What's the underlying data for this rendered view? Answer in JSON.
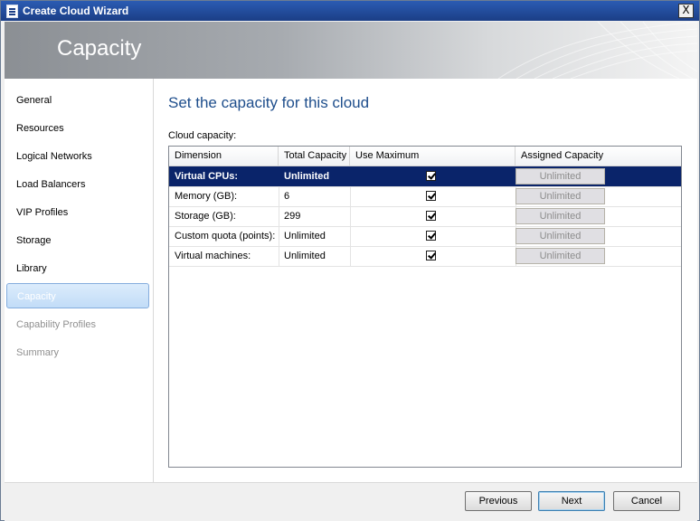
{
  "window": {
    "title": "Create Cloud Wizard",
    "close_label": "X"
  },
  "banner": {
    "heading": "Capacity"
  },
  "sidebar": {
    "items": [
      {
        "label": "General",
        "state": "normal"
      },
      {
        "label": "Resources",
        "state": "normal"
      },
      {
        "label": "Logical Networks",
        "state": "normal"
      },
      {
        "label": "Load Balancers",
        "state": "normal"
      },
      {
        "label": "VIP Profiles",
        "state": "normal"
      },
      {
        "label": "Storage",
        "state": "normal"
      },
      {
        "label": "Library",
        "state": "normal"
      },
      {
        "label": "Capacity",
        "state": "selected"
      },
      {
        "label": "Capability Profiles",
        "state": "disabled"
      },
      {
        "label": "Summary",
        "state": "disabled"
      }
    ]
  },
  "main": {
    "heading": "Set the capacity for this cloud",
    "section_label": "Cloud capacity:",
    "columns": [
      "Dimension",
      "Total Capacity",
      "Use Maximum",
      "Assigned Capacity"
    ],
    "rows": [
      {
        "dimension": "Virtual CPUs:",
        "total": "Unlimited",
        "use_max": true,
        "assigned": "Unlimited",
        "selected": true
      },
      {
        "dimension": "Memory (GB):",
        "total": "6",
        "use_max": true,
        "assigned": "Unlimited",
        "selected": false
      },
      {
        "dimension": "Storage (GB):",
        "total": "299",
        "use_max": true,
        "assigned": "Unlimited",
        "selected": false
      },
      {
        "dimension": "Custom quota (points):",
        "total": "Unlimited",
        "use_max": true,
        "assigned": "Unlimited",
        "selected": false
      },
      {
        "dimension": "Virtual machines:",
        "total": "Unlimited",
        "use_max": true,
        "assigned": "Unlimited",
        "selected": false
      }
    ]
  },
  "footer": {
    "previous_label": "Previous",
    "next_label": "Next",
    "cancel_label": "Cancel"
  },
  "colors": {
    "selection": "#0a246a",
    "heading": "#1e4e8c",
    "titlebar": "#2b5cb3"
  }
}
